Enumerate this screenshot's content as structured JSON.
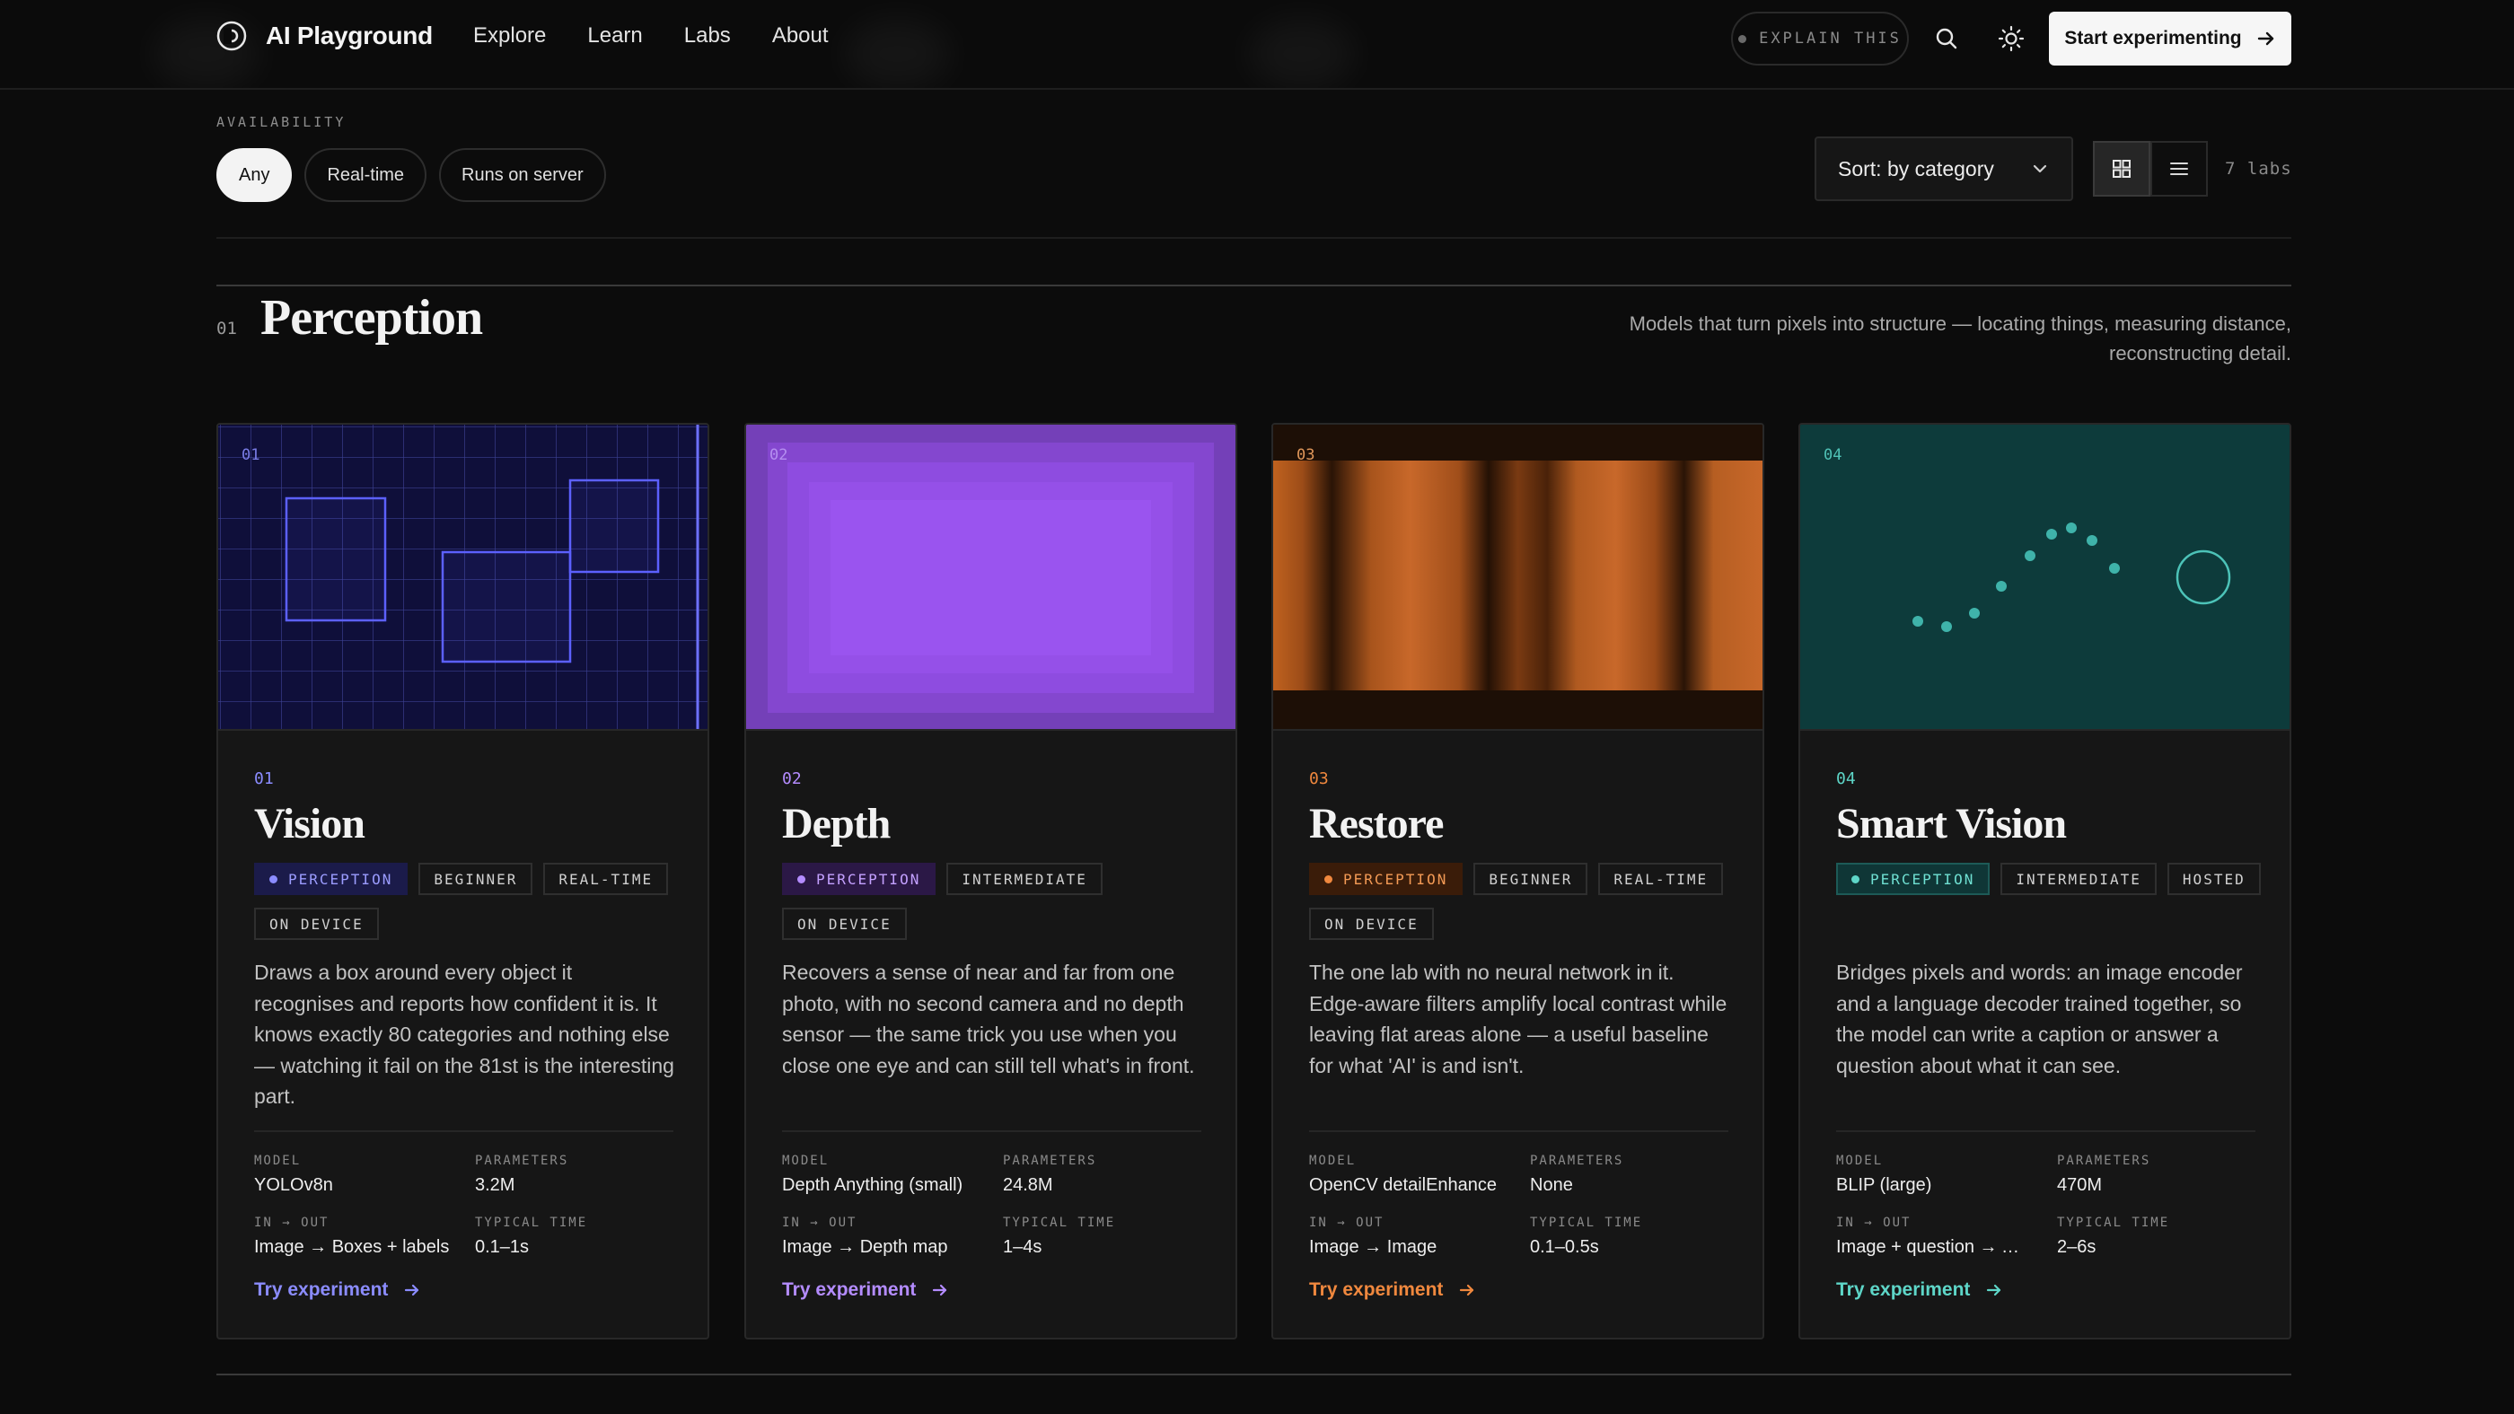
{
  "brand": {
    "name": "AI Playground"
  },
  "nav": [
    {
      "label": "Explore"
    },
    {
      "label": "Learn"
    },
    {
      "label": "Labs"
    },
    {
      "label": "About"
    }
  ],
  "header": {
    "explain_label": "EXPLAIN THIS",
    "cta_label": "Start experimenting"
  },
  "filters": {
    "availability_label": "AVAILABILITY",
    "chips": [
      {
        "label": "Any",
        "active": true
      },
      {
        "label": "Real-time",
        "active": false
      },
      {
        "label": "Runs on server",
        "active": false
      }
    ],
    "sort_label": "Sort: by category",
    "view_mode": "grid",
    "count_label": "7 labs"
  },
  "section": {
    "number": "01",
    "title": "Perception",
    "description": "Models that turn pixels into structure — locating things, measuring distance, reconstructing detail."
  },
  "colors": {
    "vision": "#8b8cff",
    "depth": "#b48cff",
    "restore": "#f0883e",
    "smart": "#5ed6c8"
  },
  "cards": [
    {
      "number": "01",
      "title": "Vision",
      "tags": [
        "PERCEPTION",
        "BEGINNER",
        "REAL-TIME",
        "ON DEVICE"
      ],
      "description": "Draws a box around every object it recognises and reports how confident it is. It knows exactly 80 categories and nothing else — watching it fail on the 81st is the interesting part.",
      "meta": [
        {
          "key": "MODEL",
          "value": "YOLOv8n"
        },
        {
          "key": "PARAMETERS",
          "value": "3.2M"
        },
        {
          "key": "IN → OUT",
          "value": "Image → Boxes + labels"
        },
        {
          "key": "TYPICAL TIME",
          "value": "0.1–1s"
        }
      ],
      "try_label": "Try experiment"
    },
    {
      "number": "02",
      "title": "Depth",
      "tags": [
        "PERCEPTION",
        "INTERMEDIATE",
        "ON DEVICE"
      ],
      "description": "Recovers a sense of near and far from one photo, with no second camera and no depth sensor — the same trick you use when you close one eye and can still tell what's in front.",
      "meta": [
        {
          "key": "MODEL",
          "value": "Depth Anything (small)"
        },
        {
          "key": "PARAMETERS",
          "value": "24.8M"
        },
        {
          "key": "IN → OUT",
          "value": "Image → Depth map"
        },
        {
          "key": "TYPICAL TIME",
          "value": "1–4s"
        }
      ],
      "try_label": "Try experiment"
    },
    {
      "number": "03",
      "title": "Restore",
      "tags": [
        "PERCEPTION",
        "BEGINNER",
        "REAL-TIME",
        "ON DEVICE"
      ],
      "description": "The one lab with no neural network in it. Edge-aware filters amplify local contrast while leaving flat areas alone — a useful baseline for what 'AI' is and isn't.",
      "meta": [
        {
          "key": "MODEL",
          "value": "OpenCV detailEnhance"
        },
        {
          "key": "PARAMETERS",
          "value": "None"
        },
        {
          "key": "IN → OUT",
          "value": "Image → Image"
        },
        {
          "key": "TYPICAL TIME",
          "value": "0.1–0.5s"
        }
      ],
      "try_label": "Try experiment"
    },
    {
      "number": "04",
      "title": "Smart Vision",
      "tags": [
        "PERCEPTION",
        "INTERMEDIATE",
        "HOSTED"
      ],
      "description": "Bridges pixels and words: an image encoder and a language decoder trained together, so the model can write a caption or answer a question about what it can see.",
      "meta": [
        {
          "key": "MODEL",
          "value": "BLIP (large)"
        },
        {
          "key": "PARAMETERS",
          "value": "470M"
        },
        {
          "key": "IN → OUT",
          "value": "Image + question → Answer"
        },
        {
          "key": "TYPICAL TIME",
          "value": "2–6s"
        }
      ],
      "try_label": "Try experiment"
    }
  ]
}
